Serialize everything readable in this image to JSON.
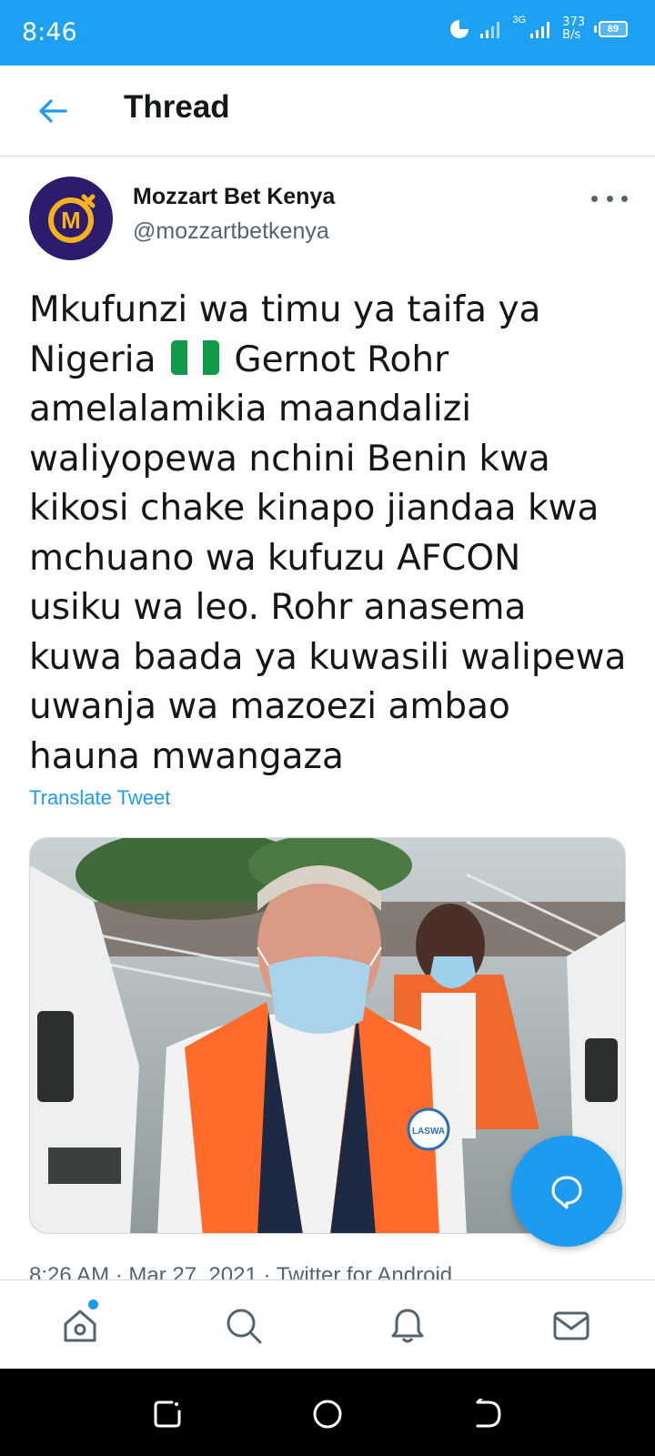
{
  "status_bar": {
    "time": "8:46",
    "net_speed_value": "373",
    "net_speed_unit": "B/s",
    "network_type": "3G",
    "battery": "89"
  },
  "header": {
    "title": "Thread"
  },
  "tweet": {
    "author_name": "Mozzart Bet Kenya",
    "author_handle": "@mozzartbetkenya",
    "text_lines": [
      "Mkufunzi wa timu ya taifa ya",
      "Nigeria",
      "Gernot Rohr",
      "amelalamikia maandalizi",
      "waliyopewa nchini Benin kwa",
      "kikosi chake kinapo jiandaa kwa",
      "mchuano wa kufuzu AFCON",
      "usiku wa leo. Rohr anasema",
      "kuwa baada ya kuwasili walipewa",
      "uwanja wa mazoezi ambao",
      "hauna mwangaza"
    ],
    "flag_icon": "nigeria-flag-icon",
    "translate_label": "Translate Tweet",
    "meta": "8:26 AM · Mar 27, 2021 · Twitter for Android",
    "media_vest_text": "LASWA"
  },
  "bottom_nav": {
    "items": [
      "home-icon",
      "search-icon",
      "notifications-icon",
      "messages-icon"
    ]
  },
  "colors": {
    "accent": "#1d9bf0",
    "status_bar": "#1da1f2",
    "text_primary": "#14171a",
    "text_secondary": "#536471",
    "avatar_bg": "#2d1b6e",
    "avatar_logo": "#f5b21b"
  }
}
